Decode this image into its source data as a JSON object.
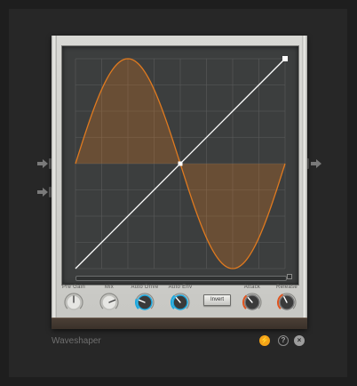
{
  "device": {
    "name": "Waveshaper"
  },
  "controls": [
    {
      "id": "pre-gain",
      "label": "Pre Gain",
      "style": "white",
      "value": 0.5
    },
    {
      "id": "mix",
      "label": "Mix",
      "style": "white",
      "value": 0.75
    },
    {
      "id": "auto-drive",
      "label": "Auto Drive",
      "style": "blue",
      "value": 0.25
    },
    {
      "id": "auto-env",
      "label": "Auto Env",
      "style": "blue",
      "value": 0.35
    },
    {
      "id": "attack",
      "label": "Attack",
      "style": "orange",
      "value": 0.35
    },
    {
      "id": "release",
      "label": "Release",
      "style": "orange",
      "value": 0.4
    }
  ],
  "invert": {
    "label": "Invert"
  },
  "footer": {
    "power_icon": "power-icon",
    "help_symbol": "?",
    "close_symbol": "×"
  },
  "colors": {
    "curve": "#e07a1f",
    "transfer_line": "#ffffff",
    "display_bg": "#3c3e3e",
    "grid": "#5a5c5c",
    "knob_blue": "#19a8e0",
    "knob_orange": "#e0541f",
    "power": "#f5a318"
  }
}
